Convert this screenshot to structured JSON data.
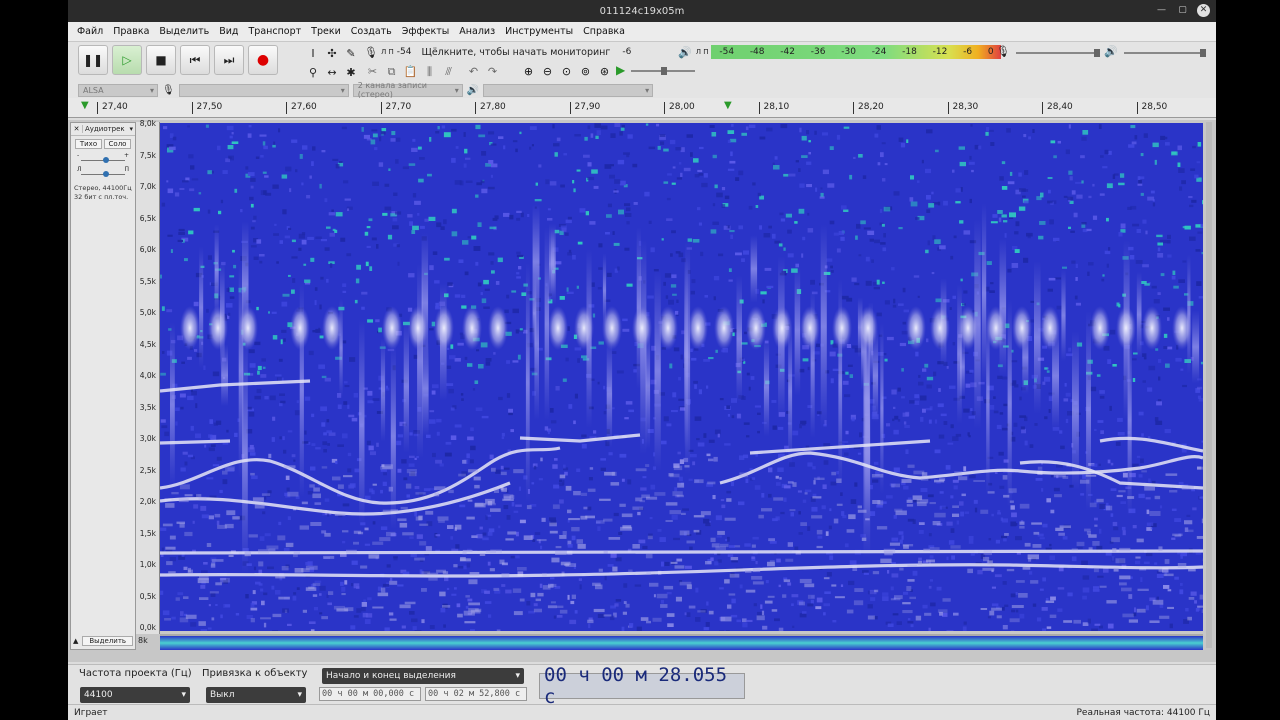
{
  "window": {
    "title": "011124c19x05m"
  },
  "menu": [
    "Файл",
    "Правка",
    "Выделить",
    "Вид",
    "Транспорт",
    "Треки",
    "Создать",
    "Эффекты",
    "Анализ",
    "Инструменты",
    "Справка"
  ],
  "meters": {
    "rec_channels": "Л П",
    "rec_min": "-54",
    "rec_prompt": "Щёлкните, чтобы начать мониторинг",
    "rec_max": "-6",
    "play_channels": "Л П",
    "play_ticks": [
      "-54",
      "-48",
      "-42",
      "-36",
      "-30",
      "-24",
      "-18",
      "-12",
      "-6",
      "0"
    ]
  },
  "devices": {
    "host": "ALSA",
    "rec_channels": "2 канала записи (стерео)"
  },
  "ruler": {
    "ticks": [
      "27,40",
      "27,50",
      "27,60",
      "27,70",
      "27,80",
      "27,90",
      "28,00",
      "28,10",
      "28,20",
      "28,30",
      "28,40",
      "28,50"
    ]
  },
  "track": {
    "name": "Аудиотрек",
    "mute": "Тихо",
    "solo": "Соло",
    "gain_minus": "-",
    "gain_plus": "+",
    "pan_left": "Л",
    "pan_right": "П",
    "info_line1": "Стерео, 44100Гц",
    "info_line2": "32 бит с пл.точ.",
    "select_label": "Выделить",
    "freq_labels": [
      "8,0k",
      "7,5k",
      "7,0k",
      "6,5k",
      "6,0k",
      "5,5k",
      "5,0k",
      "4,5k",
      "4,0k",
      "3,5k",
      "3,0k",
      "2,5k",
      "2,0k",
      "1,5k",
      "1,0k",
      "0,5k",
      "0,0k"
    ],
    "lower_label": "8k"
  },
  "selection": {
    "rate_label": "Частота проекта (Гц)",
    "rate_value": "44100",
    "snap_label": "Привязка к объекту",
    "snap_value": "Выкл",
    "mode_value": "Начало и конец выделения",
    "start_time": "00 ч 00 м 00,000 с",
    "end_time": "00 ч 02 м 52,800 с",
    "audio_position": "00 ч 00 м 28.055 с"
  },
  "status": {
    "state": "Играет",
    "actual_rate": "Реальная частота: 44100 Гц"
  },
  "colors": {
    "spectrogram_bg": "#2a34c8",
    "spectrogram_hot": "#e8e8f8",
    "spectrogram_cyan": "#30c8c0"
  }
}
